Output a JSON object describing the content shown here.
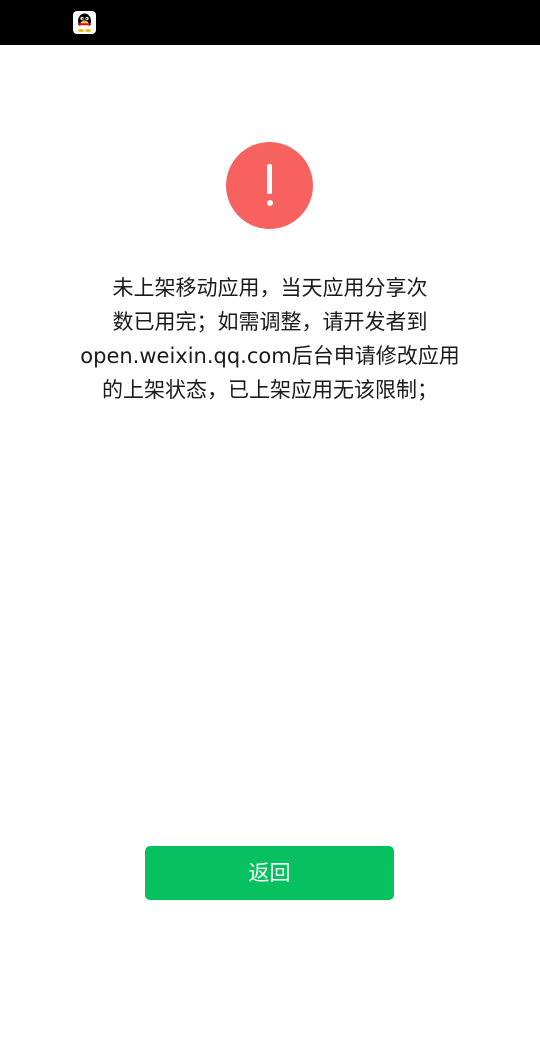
{
  "status_bar": {
    "app_icon": "qq-penguin-icon"
  },
  "alert": {
    "icon": "warning-exclamation-icon",
    "icon_color": "#f76260",
    "message_lines": [
      "未上架移动应用，当天应用分享次",
      "数已用完；如需调整，请开发者到",
      "open.weixin.qq.com后台申请修改应用",
      "的上架状态，已上架应用无该限制；"
    ]
  },
  "actions": {
    "back_label": "返回",
    "back_color": "#07c160"
  }
}
